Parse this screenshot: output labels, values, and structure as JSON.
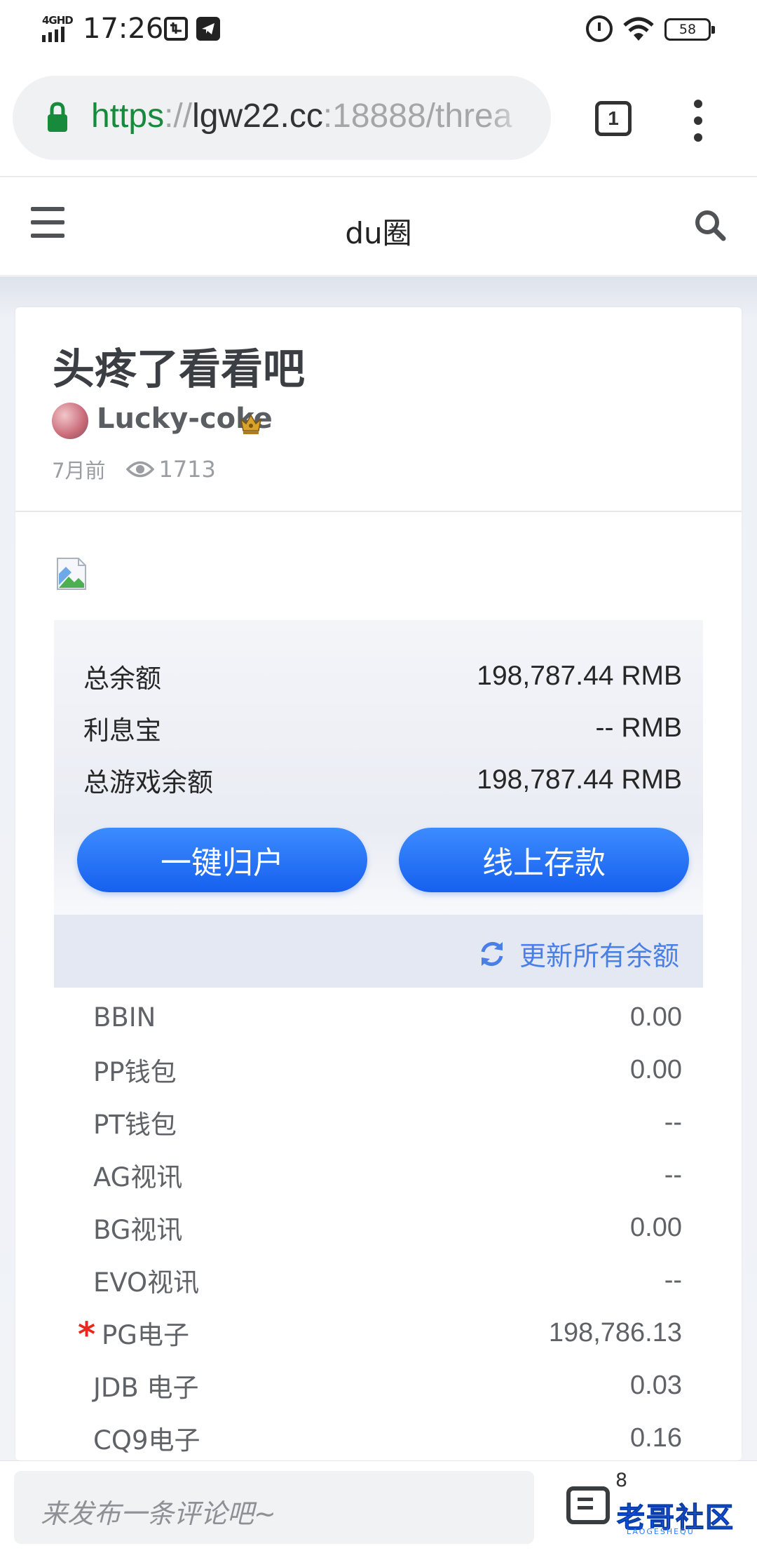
{
  "status_bar": {
    "network": "4GHD",
    "time": "17:26",
    "battery": "58"
  },
  "browser": {
    "url_scheme": "https",
    "url_sep": "://",
    "url_host": "lgw22.cc",
    "url_rest": ":18888/threa",
    "tab_count": "1"
  },
  "header": {
    "site_title": "du圈"
  },
  "post": {
    "title": "头疼了看看吧",
    "author": "Lucky-coke",
    "time": "7月前",
    "views": "1713"
  },
  "balance": {
    "rows": [
      {
        "label": "总余额",
        "value": "198,787.44 RMB"
      },
      {
        "label": "利息宝",
        "value": "-- RMB"
      },
      {
        "label": "总游戏余额",
        "value": "198,787.44 RMB"
      }
    ],
    "btn_collect": "一键归户",
    "btn_deposit": "线上存款",
    "refresh_label": "更新所有余额"
  },
  "games": [
    {
      "name": "BBIN",
      "value": "0.00"
    },
    {
      "name": "PP钱包",
      "value": "0.00"
    },
    {
      "name": "PT钱包",
      "value": "--"
    },
    {
      "name": "AG视讯",
      "value": "--"
    },
    {
      "name": "BG视讯",
      "value": "0.00"
    },
    {
      "name": "EVO视讯",
      "value": "--"
    },
    {
      "name": "PG电子",
      "value": "198,786.13"
    },
    {
      "name": "JDB 电子",
      "value": "0.03"
    },
    {
      "name": "CQ9电子",
      "value": "0.16"
    }
  ],
  "bottom": {
    "comment_placeholder": "来发布一条评论吧~",
    "comment_count": "8",
    "watermark": "老哥社区",
    "watermark_sub": "LAOGESHEQU"
  },
  "colors": {
    "accent_blue": "#1f6df5",
    "url_green": "#178a3c",
    "star_red": "#e8271e"
  }
}
